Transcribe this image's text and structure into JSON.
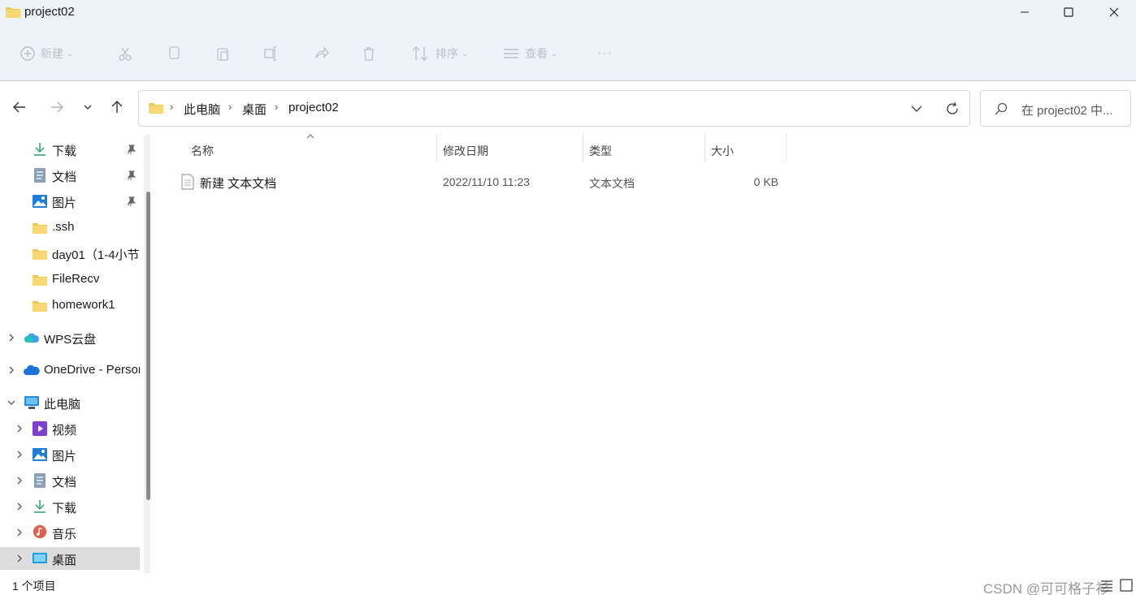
{
  "window": {
    "title": "project02",
    "minimize_icon": "minimize-icon",
    "maximize_icon": "maximize-icon",
    "close_icon": "close-icon"
  },
  "toolbar": {
    "new_label": "新建",
    "sort_label": "排序",
    "view_label": "查看",
    "more_label": "···",
    "disabled_color": "#b8c0cc"
  },
  "nav": {
    "breadcrumb": [
      "此电脑",
      "桌面",
      "project02"
    ],
    "search_placeholder": "在 project02 中..."
  },
  "sidebar": {
    "quick_access": [
      {
        "label": "下载",
        "icon": "download-icon",
        "pinned": true
      },
      {
        "label": "文档",
        "icon": "document-icon",
        "pinned": true
      },
      {
        "label": "图片",
        "icon": "pictures-icon",
        "pinned": true
      },
      {
        "label": ".ssh",
        "icon": "folder-icon"
      },
      {
        "label": "day01（1-4小节",
        "icon": "folder-icon"
      },
      {
        "label": "FileRecv",
        "icon": "folder-icon"
      },
      {
        "label": "homework1",
        "icon": "folder-icon"
      }
    ],
    "wps": "WPS云盘",
    "onedrive": "OneDrive - Personal",
    "this_pc": "此电脑",
    "pc_children": [
      {
        "label": "视频",
        "icon": "video-icon"
      },
      {
        "label": "图片",
        "icon": "pictures-icon"
      },
      {
        "label": "文档",
        "icon": "document-icon"
      },
      {
        "label": "下载",
        "icon": "download-icon"
      },
      {
        "label": "音乐",
        "icon": "music-icon"
      },
      {
        "label": "桌面",
        "icon": "desktop-icon",
        "selected": true
      }
    ]
  },
  "columns": {
    "name": "名称",
    "modified": "修改日期",
    "type": "类型",
    "size": "大小"
  },
  "files": [
    {
      "name": "新建 文本文档",
      "modified": "2022/11/10 11:23",
      "type": "文本文档",
      "size": "0 KB",
      "icon": "text-file-icon"
    }
  ],
  "status": {
    "count": "1 个项目",
    "watermark": "CSDN @可可格子衫"
  }
}
